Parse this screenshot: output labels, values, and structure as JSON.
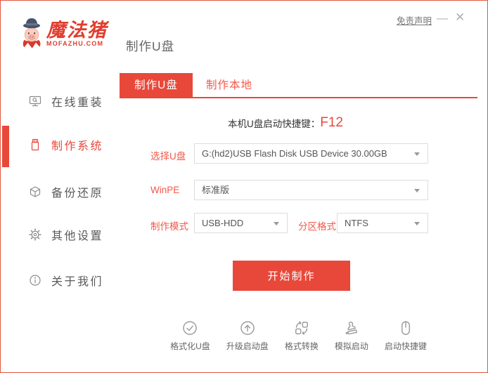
{
  "window": {
    "brand_name": "魔法猪",
    "brand_domain": "MOFAZHU.COM",
    "page_title": "制作U盘",
    "disclaimer_link": "免责声明",
    "minimize_glyph": "—",
    "close_glyph": "✕"
  },
  "sidebar": {
    "items": [
      {
        "label": "在线重装",
        "icon": "online-reinstall-monitor-icon",
        "active": false
      },
      {
        "label": "制作系统",
        "icon": "usb-drive-icon",
        "active": true
      },
      {
        "label": "备份还原",
        "icon": "backup-restore-box-icon",
        "active": false
      },
      {
        "label": "其他设置",
        "icon": "settings-gear-icon",
        "active": false
      },
      {
        "label": "关于我们",
        "icon": "about-info-icon",
        "active": false
      }
    ]
  },
  "tabs": [
    {
      "label": "制作U盘",
      "active": true
    },
    {
      "label": "制作本地",
      "active": false
    }
  ],
  "form": {
    "hotkey_label": "本机U盘启动快捷键：",
    "hotkey_value": "F12",
    "usb_select": {
      "label": "选择U盘",
      "value": "G:(hd2)USB Flash Disk USB Device 30.00GB"
    },
    "winpe_select": {
      "label": "WinPE",
      "value": "标准版"
    },
    "mode_select": {
      "label": "制作模式",
      "value": "USB-HDD"
    },
    "partition_select": {
      "label": "分区格式",
      "value": "NTFS"
    },
    "start_button_label": "开始制作"
  },
  "footer_tools": [
    {
      "label": "格式化U盘",
      "icon": "format-usb-check-icon"
    },
    {
      "label": "升级启动盘",
      "icon": "upgrade-boot-arrow-icon"
    },
    {
      "label": "格式转换",
      "icon": "format-convert-icon"
    },
    {
      "label": "模拟启动",
      "icon": "simulate-boot-stamp-icon"
    },
    {
      "label": "启动快捷键",
      "icon": "boot-hotkey-mouse-icon"
    }
  ],
  "colors": {
    "accent_red": "#e8483a",
    "label_red": "#f0594a",
    "window_border_red": "#e2573f",
    "text_dark": "#333333",
    "text_gray": "#666666",
    "icon_gray": "#9b9b9b",
    "select_border": "#dddddd"
  }
}
